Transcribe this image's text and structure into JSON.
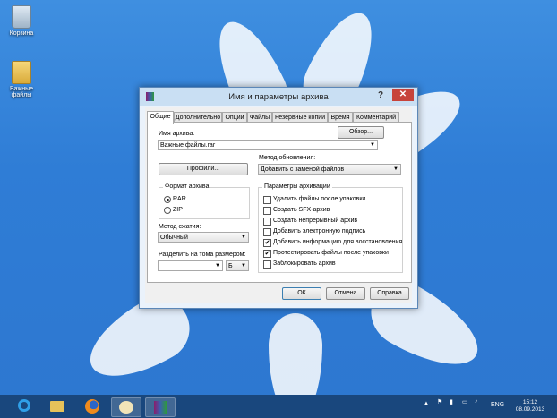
{
  "desktop": {
    "icons": [
      {
        "label": "Корзина"
      },
      {
        "label": "Важные файлы"
      }
    ]
  },
  "dialog": {
    "title": "Имя и параметры архива",
    "help_glyph": "?",
    "close_glyph": "✕",
    "tabs": [
      {
        "label": "Общие",
        "active": true
      },
      {
        "label": "Дополнительно"
      },
      {
        "label": "Опции"
      },
      {
        "label": "Файлы"
      },
      {
        "label": "Резервные копии"
      },
      {
        "label": "Время"
      },
      {
        "label": "Комментарий"
      }
    ],
    "archive_name_label": "Имя архива:",
    "archive_name_value": "Важные файлы.rar",
    "browse_button": "Обзор...",
    "profiles_button": "Профили...",
    "update_method_label": "Метод обновления:",
    "update_method_value": "Добавить с заменой файлов",
    "format_group": {
      "title": "Формат архива",
      "options": [
        {
          "label": "RAR",
          "selected": true
        },
        {
          "label": "ZIP",
          "selected": false
        }
      ]
    },
    "compression_label": "Метод сжатия:",
    "compression_value": "Обычный",
    "split_label": "Разделить на тома размером:",
    "split_value": "",
    "split_unit": "Б",
    "params_group": {
      "title": "Параметры архивации",
      "options": [
        {
          "label": "Удалить файлы после упаковки",
          "checked": false
        },
        {
          "label": "Создать SFX-архив",
          "checked": false
        },
        {
          "label": "Создать непрерывный архив",
          "checked": false
        },
        {
          "label": "Добавить электронную подпись",
          "checked": false
        },
        {
          "label": "Добавить информацию для восстановления",
          "checked": true
        },
        {
          "label": "Протестировать файлы после упаковки",
          "checked": true
        },
        {
          "label": "Заблокировать архив",
          "checked": false
        }
      ]
    },
    "ok_button": "ОК",
    "cancel_button": "Отмена",
    "help_button": "Справка"
  },
  "taskbar": {
    "language": "ENG",
    "time": "15:12",
    "date": "08.09.2013",
    "tray_up_glyph": "▲"
  },
  "colors": {
    "desktop": "#2f7dd6",
    "close_button": "#c7433a",
    "titlebar": "#c9dff3"
  }
}
